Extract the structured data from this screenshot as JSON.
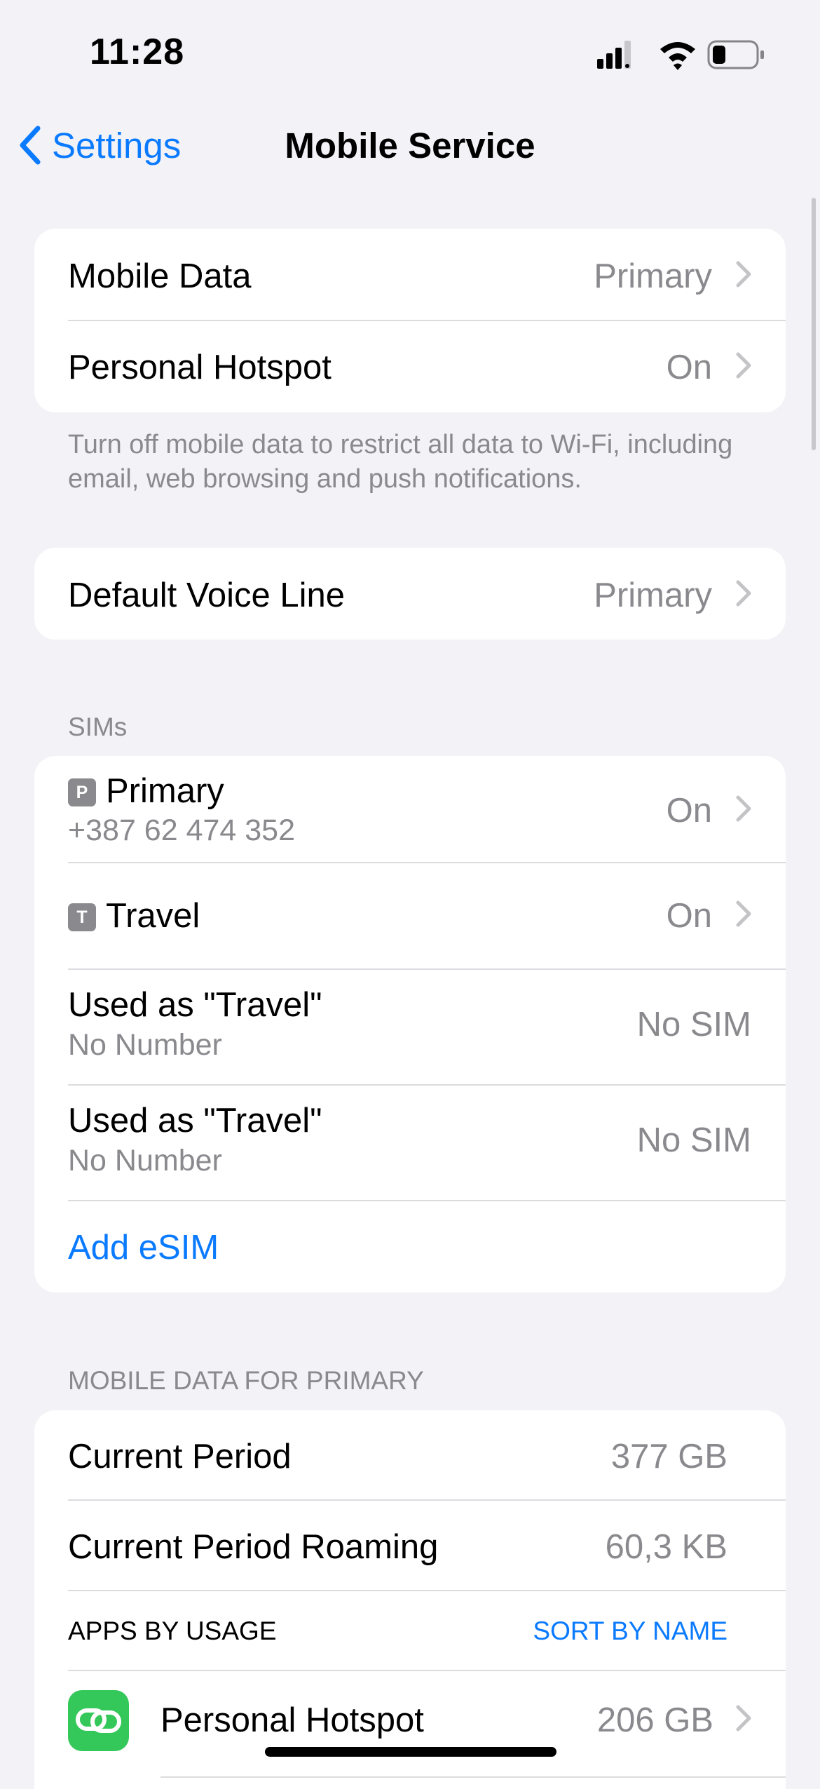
{
  "status_bar": {
    "time": "11:28"
  },
  "nav": {
    "back_label": "Settings",
    "title": "Mobile Service"
  },
  "data_group": {
    "rows": [
      {
        "label": "Mobile Data",
        "value": "Primary"
      },
      {
        "label": "Personal Hotspot",
        "value": "On"
      }
    ],
    "footer": "Turn off mobile data to restrict all data to Wi-Fi, including email, web browsing and push notifications."
  },
  "voice_group": {
    "label": "Default Voice Line",
    "value": "Primary"
  },
  "sims": {
    "header": "SIMs",
    "primary": {
      "badge": "P",
      "label": "Primary",
      "number": "+387 62 474 352",
      "value": "On"
    },
    "travel": {
      "badge": "T",
      "label": "Travel",
      "value": "On"
    },
    "used_rows": [
      {
        "label": "Used as \"Travel\"",
        "sub": "No Number",
        "value": "No SIM"
      },
      {
        "label": "Used as \"Travel\"",
        "sub": "No Number",
        "value": "No SIM"
      }
    ],
    "add_esim": "Add eSIM"
  },
  "mobile_data": {
    "header": "MOBILE DATA FOR PRIMARY",
    "rows": [
      {
        "label": "Current Period",
        "value": "377 GB"
      },
      {
        "label": "Current Period Roaming",
        "value": "60,3 KB"
      }
    ],
    "apps_header": "APPS BY USAGE",
    "sort_label": "SORT BY NAME",
    "apps": [
      {
        "name": "Personal Hotspot",
        "value": "206 GB",
        "icon": "hotspot-link-icon",
        "icon_color": "#34c759"
      }
    ]
  },
  "colors": {
    "accent": "#0a7aff",
    "background": "#f2f2f7",
    "secondary_text": "#8a8a8e"
  }
}
